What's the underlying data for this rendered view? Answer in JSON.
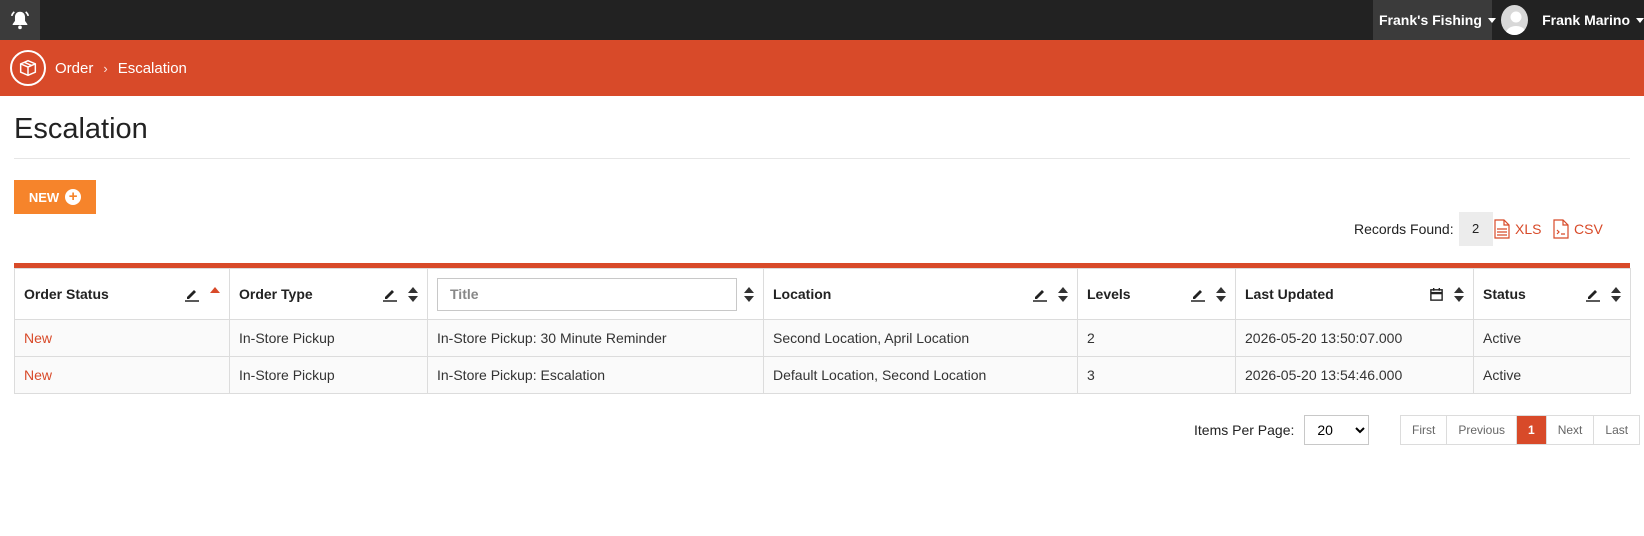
{
  "topbar": {
    "store_name": "Frank's Fishing",
    "user_name": "Frank Marino"
  },
  "breadcrumb": {
    "root": "Order",
    "current": "Escalation"
  },
  "page": {
    "title": "Escalation",
    "new_button": "NEW"
  },
  "records": {
    "label": "Records Found:",
    "count": "2",
    "xls": "XLS",
    "csv": "CSV"
  },
  "table": {
    "columns": {
      "order_status": "Order Status",
      "order_type": "Order Type",
      "title_placeholder": "Title",
      "location": "Location",
      "levels": "Levels",
      "last_updated": "Last Updated",
      "status": "Status"
    },
    "rows": [
      {
        "order_status": "New",
        "order_type": "In-Store Pickup",
        "title": "In-Store Pickup: 30 Minute Reminder",
        "location": "Second Location, April Location",
        "levels": "2",
        "last_updated": "2026-05-20 13:50:07.000",
        "status": "Active"
      },
      {
        "order_status": "New",
        "order_type": "In-Store Pickup",
        "title": "In-Store Pickup: Escalation",
        "location": "Default Location, Second Location",
        "levels": "3",
        "last_updated": "2026-05-20 13:54:46.000",
        "status": "Active"
      }
    ]
  },
  "pagination": {
    "items_per_page_label": "Items Per Page:",
    "items_per_page": "20",
    "first": "First",
    "previous": "Previous",
    "current_page": "1",
    "next": "Next",
    "last": "Last"
  },
  "colors": {
    "brand": "#d84a29",
    "accent_button": "#f6842b",
    "topbar": "#222222"
  },
  "icons": {
    "notifications": "bell-icon",
    "breadcrumb": "package-box-icon",
    "edit": "pencil-icon",
    "calendar": "calendar-icon",
    "sort": "sort-icon",
    "xls": "xls-file-icon",
    "csv": "csv-file-icon"
  }
}
